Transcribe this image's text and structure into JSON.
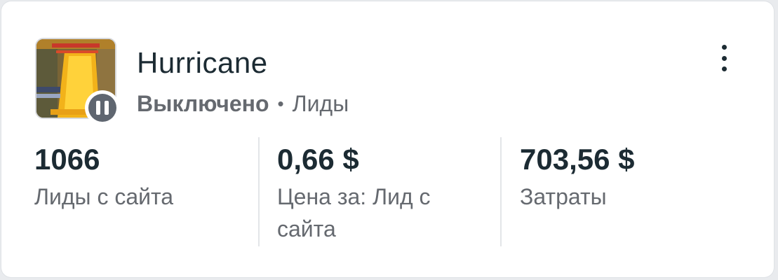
{
  "campaign": {
    "name": "Hurricane",
    "status": "Выключено",
    "separator": "•",
    "objective": "Лиды",
    "thumbnail_icon": "ad-thumbnail-image",
    "status_icon": "pause-icon"
  },
  "menu": {
    "icon": "more-options-vertical-icon"
  },
  "metrics": [
    {
      "value": "1066",
      "label": "Лиды с сайта"
    },
    {
      "value": "0,66 $",
      "label": "Цена за: Лид с сайта"
    },
    {
      "value": "703,56 $",
      "label": "Затраты"
    }
  ],
  "colors": {
    "text_primary": "#1c2b33",
    "text_secondary": "#65696f",
    "status_badge": "#5f6670"
  }
}
